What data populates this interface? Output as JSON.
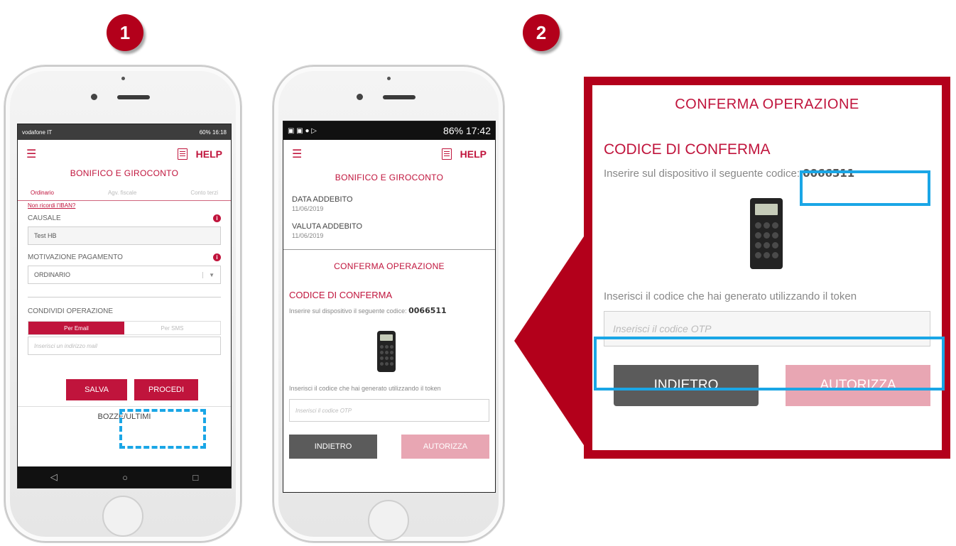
{
  "steps": [
    "1",
    "2"
  ],
  "phone1": {
    "status_left": "vodafone IT",
    "status_right": "60% 16:18",
    "help": "HELP",
    "title": "BONIFICO E GIROCONTO",
    "tabs": [
      "Ordinario",
      "Agv. fiscale",
      "Conto terzi"
    ],
    "iban_link": "Non ricordi l'IBAN?",
    "causale_label": "CAUSALE",
    "causale_value": "Test HB",
    "motivazione_label": "MOTIVAZIONE PAGAMENTO",
    "motivazione_value": "ORDINARIO",
    "condividi_label": "CONDIVIDI OPERAZIONE",
    "share_email": "Per Email",
    "share_sms": "Per SMS",
    "email_placeholder": "Inserisci un indirizzo mail",
    "salva": "SALVA",
    "procedi": "PROCEDI",
    "bozze": "BOZZE/ULTIMI",
    "nav": [
      "◁",
      "○",
      "□"
    ]
  },
  "phone2": {
    "status_right": "86% 17:42",
    "help": "HELP",
    "title": "BONIFICO E GIROCONTO",
    "data_label": "DATA ADDEBITO",
    "data_value": "11/06/2019",
    "valuta_label": "VALUTA ADDEBITO",
    "valuta_value": "11/06/2019",
    "conferma": "CONFERMA OPERAZIONE",
    "codice_title": "CODICE DI CONFERMA",
    "codice_text": "Inserire sul dispositivo il seguente codice:",
    "codice_value": "0066511",
    "token_text": "Inserisci il codice che hai generato utilizzando il token",
    "otp_placeholder": "Inserisci il codice OTP",
    "indietro": "INDIETRO",
    "autorizza": "AUTORIZZA"
  },
  "zoom": {
    "conferma": "CONFERMA OPERAZIONE",
    "codice_title": "CODICE DI CONFERMA",
    "codice_text": "Inserire sul dispositivo il seguente",
    "codice_word": "codice:",
    "codice_value": "0066511",
    "token_text": "Inserisci il codice che hai generato utilizzando il token",
    "otp_placeholder": "Inserisci il codice OTP",
    "indietro": "INDIETRO",
    "autorizza": "AUTORIZZA"
  },
  "colors": {
    "brand": "#c0143c",
    "frame": "#b3001b",
    "highlight": "#1aa6e6"
  }
}
